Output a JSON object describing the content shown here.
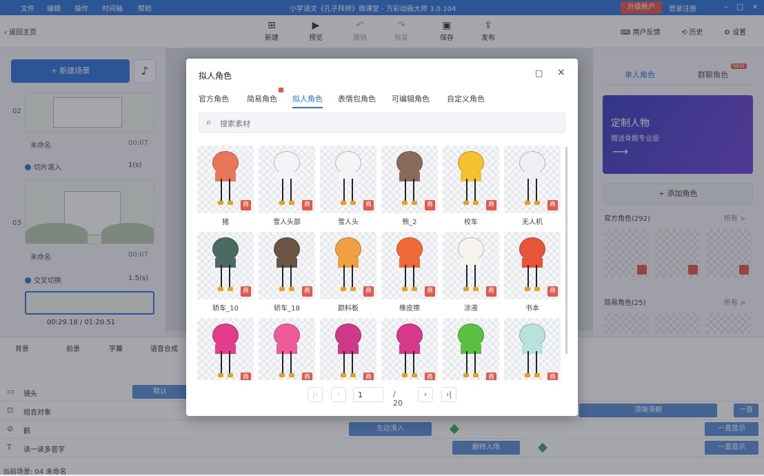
{
  "window": {
    "title": "小学语文《孔子拜师》微课堂 - 万彩动画大师 3.0.104",
    "menu": [
      "文件",
      "编辑",
      "操作",
      "时间轴",
      "帮助"
    ],
    "upgrade": "升级账户",
    "login": "登录注册"
  },
  "toolbar": {
    "back": "返回主页",
    "buttons": [
      "新建",
      "预览",
      "撤销",
      "恢复",
      "保存",
      "发布"
    ],
    "feedback": "用户反馈",
    "history": "历史",
    "settings": "设置"
  },
  "left": {
    "new_scene": "+ 新建场景",
    "scenes": [
      {
        "num": "02",
        "name": "未命名",
        "time": "00:07",
        "transition": "切片滚入",
        "trans_val": "1(s)"
      },
      {
        "num": "03",
        "name": "未命名",
        "time": "00:07",
        "transition": "交叉切换",
        "trans_val": "1.5(s)"
      }
    ],
    "timecode": "00:29.18 / 01:20.51"
  },
  "right": {
    "tab1": "单人角色",
    "tab2": "群聊角色",
    "new": "NEW",
    "banner_title": "定制人物",
    "banner_sub": "赠送骨骼专业版",
    "add_role": "+ 添加角色",
    "official": "官方角色(292)",
    "more1": "所有 >",
    "common": "简易角色(25)",
    "more2": "所有 >"
  },
  "bottom": {
    "tabs": [
      "背景",
      "前景",
      "字幕",
      "语音合成"
    ],
    "rows": [
      "镜头",
      "组合对象",
      "鹤",
      "读一读多音字"
    ],
    "chips": [
      "默认",
      "左边滑入",
      "翻转入场",
      "顶端滑翻",
      "一直",
      "一直显示",
      "一直显示"
    ]
  },
  "status": "当前场景: 04  未命名",
  "dialog": {
    "title": "拟人角色",
    "tabs": [
      "官方角色",
      "简易角色",
      "拟人角色",
      "表情包角色",
      "可编辑角色",
      "自定义角色"
    ],
    "search_placeholder": "搜索素材",
    "items": [
      {
        "name": "猪",
        "color": "#e8775a"
      },
      {
        "name": "雪人头部",
        "color": "#f2f4f6"
      },
      {
        "name": "雪人头",
        "color": "#f2f4f6"
      },
      {
        "name": "熊_2",
        "color": "#8a6a5c"
      },
      {
        "name": "校车",
        "color": "#f2c230"
      },
      {
        "name": "无人机",
        "color": "#f0eef2"
      },
      {
        "name": "轿车_10",
        "color": "#4a6a62"
      },
      {
        "name": "轿车_18",
        "color": "#6a5544"
      },
      {
        "name": "颜料板",
        "color": "#f0a040"
      },
      {
        "name": "橡皮擦",
        "color": "#ef6a35"
      },
      {
        "name": "涂液",
        "color": "#f7f4f0"
      },
      {
        "name": "书本",
        "color": "#e8543a"
      },
      {
        "name": "",
        "color": "#e23c8a"
      },
      {
        "name": "",
        "color": "#ef5a9a"
      },
      {
        "name": "",
        "color": "#d0388a"
      },
      {
        "name": "",
        "color": "#d8388a"
      },
      {
        "name": "",
        "color": "#5ac040"
      },
      {
        "name": "",
        "color": "#b8e2dc"
      }
    ],
    "page": "1",
    "total": "/ 20"
  }
}
